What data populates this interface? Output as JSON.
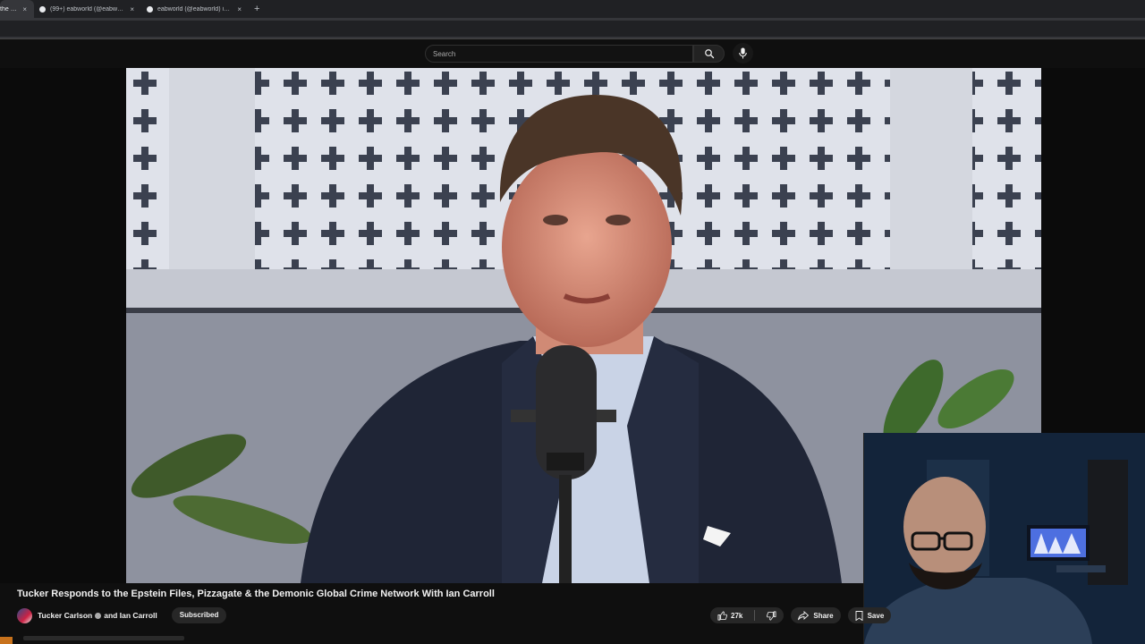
{
  "browser": {
    "tabs": [
      {
        "title": "the Ep…",
        "active": true
      },
      {
        "title": "(99+) eabworld (@eabworld) | T…",
        "active": false
      },
      {
        "title": "eabworld (@eabworld) is LIVE",
        "active": false
      }
    ],
    "new_tab_label": "+",
    "close_glyph": "×"
  },
  "masthead": {
    "search_placeholder": "Search",
    "search_icon": "search-icon",
    "mic_icon": "mic-icon"
  },
  "video": {
    "title": "Tucker Responds to the Epstein Files, Pizzagate & the Demonic Global Crime Network With Ian Carroll",
    "channel": "Tucker Carlson",
    "collaborator": "and Ian Carroll",
    "subscribe_state": "Subscribed",
    "likes": "27k",
    "share_label": "Share",
    "save_label": "Save"
  },
  "colors": {
    "background": "#0f0f0f",
    "pill": "#272727",
    "tabstrip": "#202124"
  }
}
